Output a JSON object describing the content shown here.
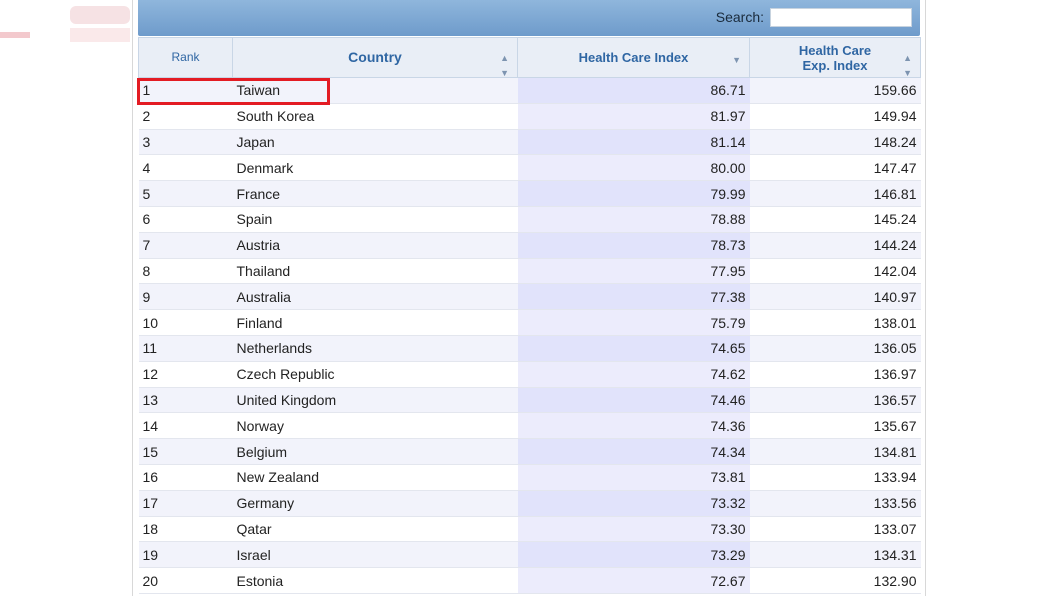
{
  "search": {
    "label": "Search:",
    "value": ""
  },
  "columns": {
    "rank": "Rank",
    "country": "Country",
    "hci": "Health Care Index",
    "exp_line1": "Health Care",
    "exp_line2": "Exp. Index"
  },
  "icons": {
    "sort_both": "sort-both-icon",
    "sort_desc": "sort-desc-icon"
  },
  "colors": {
    "highlight": "#e31b23",
    "header_text": "#2f66a3"
  },
  "rows": [
    {
      "rank": "1",
      "country": "Taiwan",
      "hci": "86.71",
      "exp": "159.66"
    },
    {
      "rank": "2",
      "country": "South Korea",
      "hci": "81.97",
      "exp": "149.94"
    },
    {
      "rank": "3",
      "country": "Japan",
      "hci": "81.14",
      "exp": "148.24"
    },
    {
      "rank": "4",
      "country": "Denmark",
      "hci": "80.00",
      "exp": "147.47"
    },
    {
      "rank": "5",
      "country": "France",
      "hci": "79.99",
      "exp": "146.81"
    },
    {
      "rank": "6",
      "country": "Spain",
      "hci": "78.88",
      "exp": "145.24"
    },
    {
      "rank": "7",
      "country": "Austria",
      "hci": "78.73",
      "exp": "144.24"
    },
    {
      "rank": "8",
      "country": "Thailand",
      "hci": "77.95",
      "exp": "142.04"
    },
    {
      "rank": "9",
      "country": "Australia",
      "hci": "77.38",
      "exp": "140.97"
    },
    {
      "rank": "10",
      "country": "Finland",
      "hci": "75.79",
      "exp": "138.01"
    },
    {
      "rank": "11",
      "country": "Netherlands",
      "hci": "74.65",
      "exp": "136.05"
    },
    {
      "rank": "12",
      "country": "Czech Republic",
      "hci": "74.62",
      "exp": "136.97"
    },
    {
      "rank": "13",
      "country": "United Kingdom",
      "hci": "74.46",
      "exp": "136.57"
    },
    {
      "rank": "14",
      "country": "Norway",
      "hci": "74.36",
      "exp": "135.67"
    },
    {
      "rank": "15",
      "country": "Belgium",
      "hci": "74.34",
      "exp": "134.81"
    },
    {
      "rank": "16",
      "country": "New Zealand",
      "hci": "73.81",
      "exp": "133.94"
    },
    {
      "rank": "17",
      "country": "Germany",
      "hci": "73.32",
      "exp": "133.56"
    },
    {
      "rank": "18",
      "country": "Qatar",
      "hci": "73.30",
      "exp": "133.07"
    },
    {
      "rank": "19",
      "country": "Israel",
      "hci": "73.29",
      "exp": "134.31"
    },
    {
      "rank": "20",
      "country": "Estonia",
      "hci": "72.67",
      "exp": "132.90"
    }
  ]
}
